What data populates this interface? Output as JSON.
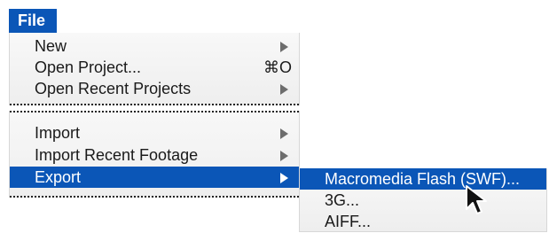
{
  "menu": {
    "title": "File",
    "sections": [
      {
        "items": [
          {
            "label": "New",
            "shortcut": "",
            "has_submenu": true
          },
          {
            "label": "Open Project...",
            "shortcut": "⌘O",
            "has_submenu": false
          },
          {
            "label": "Open Recent Projects",
            "shortcut": "",
            "has_submenu": true
          }
        ]
      },
      {
        "items": [
          {
            "label": "Import",
            "shortcut": "",
            "has_submenu": true
          },
          {
            "label": "Import Recent Footage",
            "shortcut": "",
            "has_submenu": true
          },
          {
            "label": "Export",
            "shortcut": "",
            "has_submenu": true,
            "active": true
          }
        ]
      }
    ]
  },
  "submenu": {
    "items": [
      {
        "label": "Macromedia Flash (SWF)...",
        "active": true
      },
      {
        "label": "3G...",
        "active": false
      },
      {
        "label": "AIFF...",
        "active": false
      }
    ]
  },
  "colors": {
    "highlight": "#0b56b7",
    "menu_background": "#f2f2f2",
    "text": "#1a1a1a"
  },
  "icons": {
    "submenu_arrow": "triangle-right-icon",
    "cursor": "mouse-pointer-icon"
  }
}
